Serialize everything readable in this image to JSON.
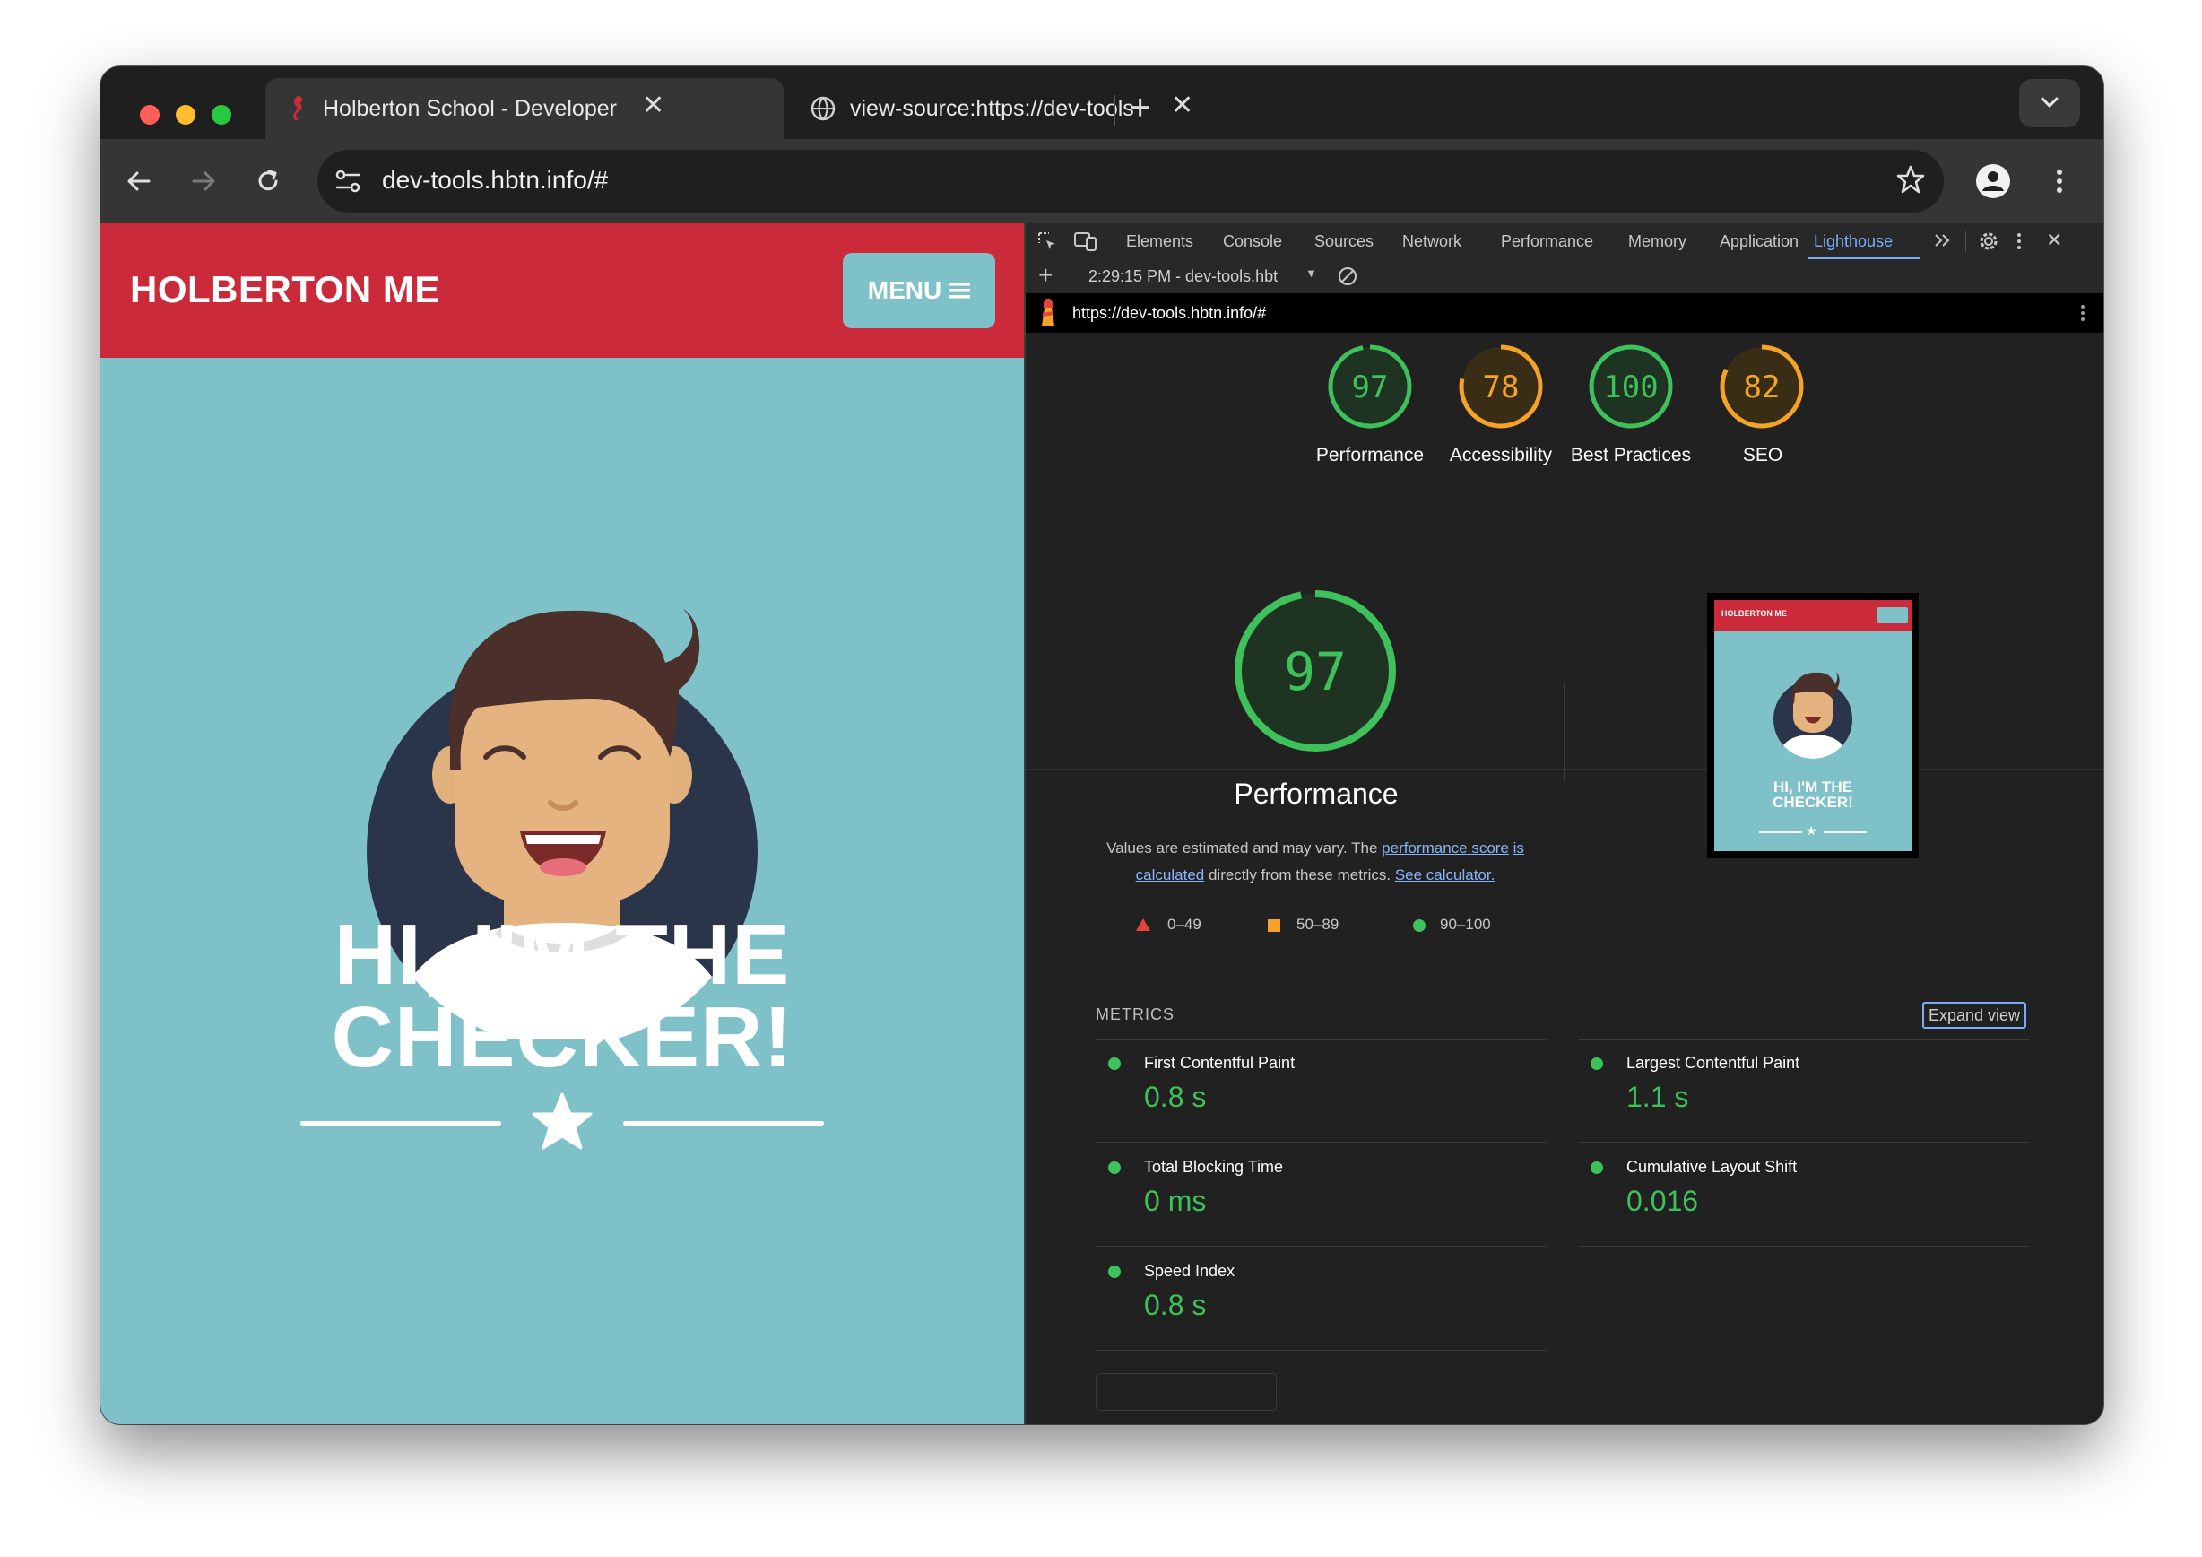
{
  "browser": {
    "tabs": [
      {
        "title": "Holberton School - Developer",
        "active": true
      },
      {
        "title": "view-source:https://dev-tools",
        "active": false
      }
    ],
    "address": "dev-tools.hbtn.info/#"
  },
  "site": {
    "logo": "HOLBERTON ME",
    "menu_label": "MENU",
    "hero_line1": "HI, I'M THE",
    "hero_line2": "CHECKER!"
  },
  "devtools": {
    "tabs": [
      "Elements",
      "Console",
      "Sources",
      "Network",
      "Performance",
      "Memory",
      "Application",
      "Lighthouse"
    ],
    "active_tab": "Lighthouse",
    "report_selector": "2:29:15 PM - dev-tools.hbt",
    "report_url": "https://dev-tools.hbtn.info/#"
  },
  "lighthouse": {
    "gauges": [
      {
        "score": "97",
        "label": "Performance",
        "color": "#3ec15a"
      },
      {
        "score": "78",
        "label": "Accessibility",
        "color": "#f4a328"
      },
      {
        "score": "100",
        "label": "Best Practices",
        "color": "#3ec15a"
      },
      {
        "score": "82",
        "label": "SEO",
        "color": "#f4a328"
      }
    ],
    "main_score": "97",
    "main_label": "Performance",
    "note_text_1": "Values are estimated and may vary. The",
    "note_link_1": "performance score",
    "note_link_2": "is calculated",
    "note_text_2": "directly from these metrics.",
    "note_link_3": "See calculator.",
    "legend": [
      {
        "range": "0–49",
        "color": "#e5443a"
      },
      {
        "range": "50–89",
        "color": "#f4a328"
      },
      {
        "range": "90–100",
        "color": "#3ec15a"
      }
    ],
    "metrics_heading": "METRICS",
    "expand_label": "Expand view",
    "metrics": [
      {
        "name": "First Contentful Paint",
        "value": "0.8 s"
      },
      {
        "name": "Largest Contentful Paint",
        "value": "1.1 s"
      },
      {
        "name": "Total Blocking Time",
        "value": "0 ms"
      },
      {
        "name": "Cumulative Layout Shift",
        "value": "0.016"
      },
      {
        "name": "Speed Index",
        "value": "0.8 s"
      }
    ],
    "thumb": {
      "logo": "HOLBERTON ME",
      "hero_line1": "HI, I'M THE",
      "hero_line2": "CHECKER!"
    }
  }
}
